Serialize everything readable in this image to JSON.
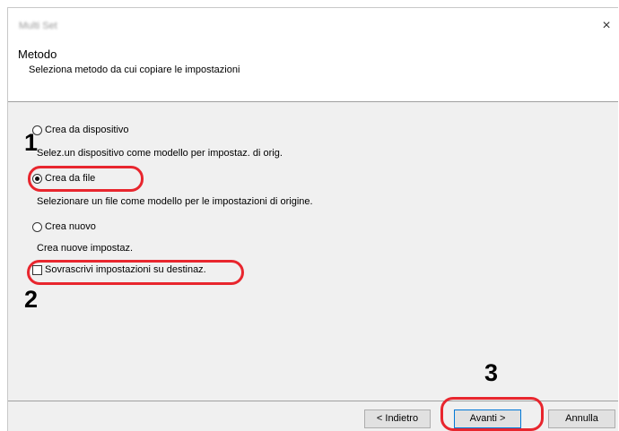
{
  "window": {
    "title": "Multi Set",
    "close_glyph": "×"
  },
  "header": {
    "title": "Metodo",
    "subtitle": "Seleziona metodo da cui copiare le impostazioni"
  },
  "options": {
    "device": {
      "label": "Crea da dispositivo",
      "desc": "Selez.un dispositivo come modello per impostaz. di orig.",
      "selected": false
    },
    "file": {
      "label": "Crea da file",
      "desc": "Selezionare un file come modello per le impostazioni di origine.",
      "selected": true
    },
    "new": {
      "label": "Crea nuovo",
      "desc": "Crea nuove impostaz.",
      "selected": false
    }
  },
  "overwrite": {
    "label": "Sovrascrivi impostazioni su destinaz.",
    "checked": false
  },
  "buttons": {
    "back": "< Indietro",
    "next": "Avanti >",
    "cancel": "Annulla"
  },
  "callouts": {
    "step1": "1",
    "step2": "2",
    "step3": "3"
  },
  "colors": {
    "callout": "#e8262e",
    "dialog_bg": "#f0f0f0",
    "default_border": "#0078d7"
  }
}
